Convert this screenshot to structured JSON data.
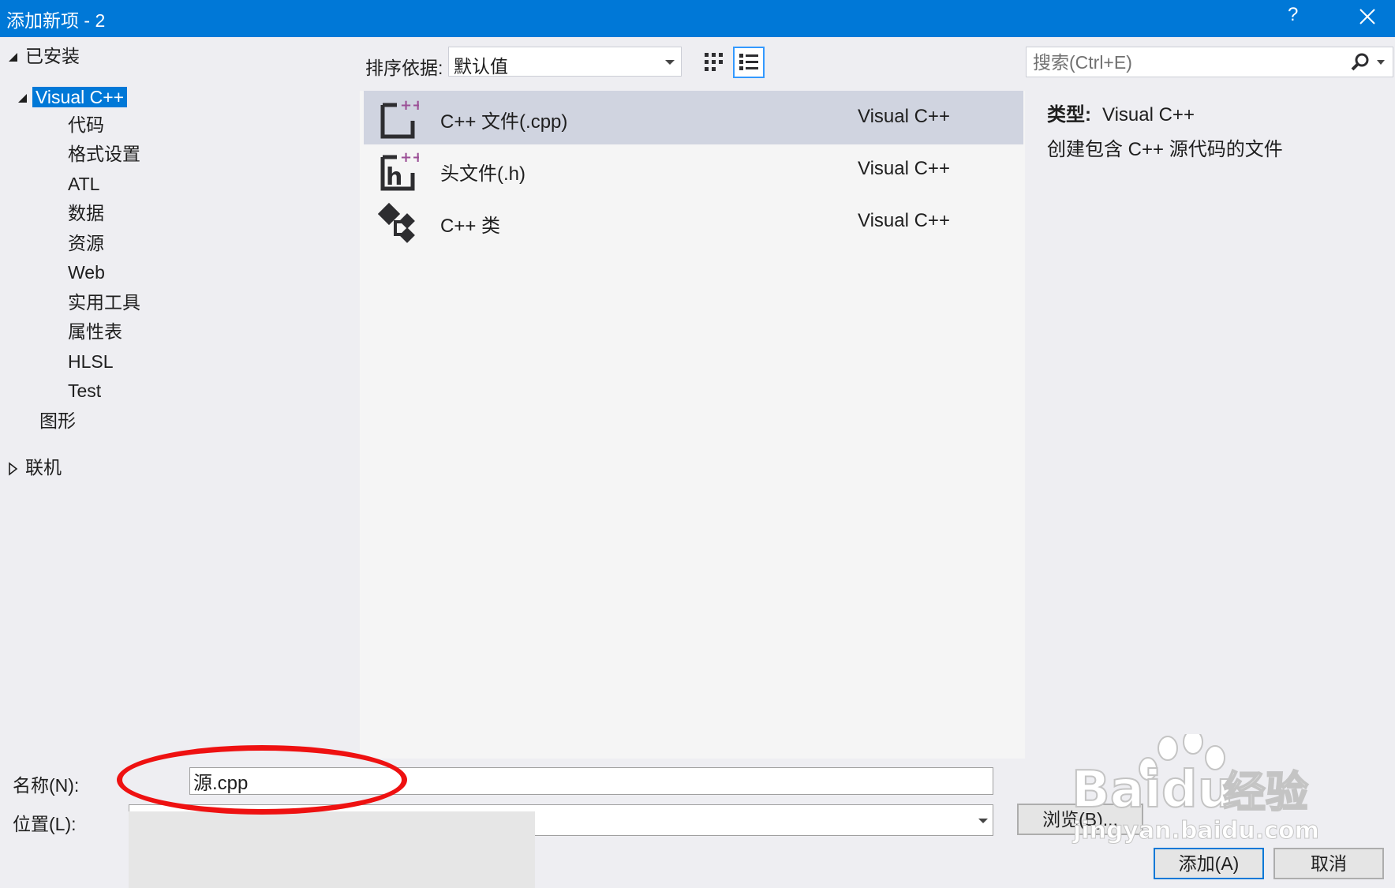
{
  "window": {
    "title": "添加新项 - 2",
    "help_label": "?"
  },
  "tree": {
    "installed_label": "已安装",
    "visual_cpp_label": "Visual C++",
    "children": [
      "代码",
      "格式设置",
      "ATL",
      "数据",
      "资源",
      "Web",
      "实用工具",
      "属性表",
      "HLSL",
      "Test"
    ],
    "graphics_label": "图形",
    "online_label": "联机"
  },
  "sort": {
    "label": "排序依据:",
    "value": "默认值"
  },
  "items": [
    {
      "name": "C++ 文件(.cpp)",
      "type": "Visual C++",
      "icon": "cpp-file-icon",
      "selected": true
    },
    {
      "name": "头文件(.h)",
      "type": "Visual C++",
      "icon": "header-file-icon",
      "selected": false
    },
    {
      "name": "C++ 类",
      "type": "Visual C++",
      "icon": "cpp-class-icon",
      "selected": false
    }
  ],
  "search": {
    "placeholder": "搜索(Ctrl+E)"
  },
  "details": {
    "type_label": "类型:",
    "type_value": "Visual C++",
    "description": "创建包含 C++ 源代码的文件"
  },
  "form": {
    "name_label": "名称(N):",
    "name_value": "源.cpp",
    "location_label": "位置(L):",
    "browse_label": "浏览(B)...",
    "add_label": "添加(A)",
    "cancel_label": "取消"
  },
  "watermark": {
    "brand": "Baidu",
    "brand_suffix": "经验",
    "url": "jingyan.baidu.com"
  },
  "colors": {
    "title_bar": "#0078d7",
    "selection": "#0078d7",
    "annotation": "#ee1111"
  }
}
